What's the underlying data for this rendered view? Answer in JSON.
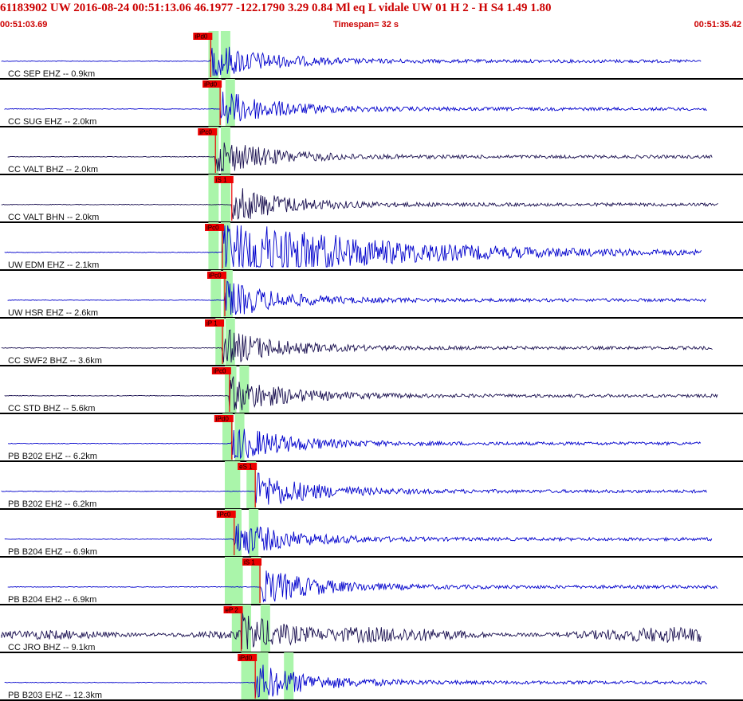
{
  "header": {
    "title": "61183902 UW 2016-08-24 00:51:13.06   46.1977 -122.1790   3.29  0.84 Ml  eq  L vidale   UW 01  H   2  -  H S4    1.49  1.80",
    "start_time": "00:51:03.69",
    "timespan": "Timespan=  32 s",
    "end_time": "00:51:35.42"
  },
  "colors": {
    "title": "#cc0000",
    "trace_blue": "#0000cc",
    "trace_dark": "#1a1050",
    "pick_red": "#ee0000",
    "window_green": "#aaf5aa",
    "separator": "#000000"
  },
  "channels": [
    {
      "label": "CC SEP EHZ -- 0.9km",
      "color": "blue",
      "picks": [
        {
          "text": "iPd0",
          "t": 9.0
        }
      ],
      "windows": [
        8.9,
        9.7
      ]
    },
    {
      "label": "CC SUG EHZ -- 2.0km",
      "color": "blue",
      "picks": [
        {
          "text": "iPd0",
          "t": 9.4
        }
      ],
      "windows": [
        8.9,
        9.9
      ]
    },
    {
      "label": "CC VALT BHZ -- 2.0km",
      "color": "dark",
      "picks": [
        {
          "text": "iPc0",
          "t": 9.2
        }
      ],
      "windows": [
        8.9,
        9.7
      ]
    },
    {
      "label": "CC VALT BHN -- 2.0km",
      "color": "dark",
      "picks": [
        {
          "text": "iS 1",
          "t": 9.9
        }
      ],
      "windows": [
        8.9,
        9.7
      ]
    },
    {
      "label": "UW EDM EHZ -- 2.1km",
      "color": "blue",
      "picks": [
        {
          "text": "iPc0",
          "t": 9.5
        }
      ],
      "windows": [
        8.9,
        9.7
      ]
    },
    {
      "label": "UW HSR EHZ -- 2.6km",
      "color": "blue",
      "picks": [
        {
          "text": "iPc0",
          "t": 9.6
        }
      ],
      "windows": [
        9.0,
        9.8
      ]
    },
    {
      "label": "CC SWF2 BHZ -- 3.6km",
      "color": "dark",
      "picks": [
        {
          "text": "iP 1",
          "t": 9.5
        }
      ],
      "windows": [
        9.2,
        9.9
      ]
    },
    {
      "label": "CC STD BHZ -- 5.6km",
      "color": "dark",
      "picks": [
        {
          "text": "iPc0",
          "t": 9.8
        }
      ],
      "windows": [
        9.6,
        10.5
      ]
    },
    {
      "label": "PB B202 EHZ -- 6.2km",
      "color": "blue",
      "picks": [
        {
          "text": "iPd0",
          "t": 9.9
        }
      ],
      "windows": [
        9.5,
        10.3
      ]
    },
    {
      "label": "PB B202 EH2 -- 6.2km",
      "color": "blue",
      "picks": [
        {
          "text": "eS 1",
          "t": 10.9
        }
      ],
      "windows": [
        9.6,
        10.8
      ]
    },
    {
      "label": "PB B204 EHZ -- 6.9km",
      "color": "blue",
      "picks": [
        {
          "text": "iPc0",
          "t": 10.0
        }
      ],
      "windows": [
        9.6,
        10.9
      ]
    },
    {
      "label": "PB B204 EH2 -- 6.9km",
      "color": "blue",
      "picks": [
        {
          "text": "iS 1",
          "t": 11.1
        }
      ],
      "windows": [
        9.6,
        11.0
      ]
    },
    {
      "label": "CC JRO BHZ -- 9.1km",
      "color": "dark",
      "picks": [
        {
          "text": "eP 2",
          "t": 10.3
        }
      ],
      "windows": [
        9.9,
        11.4
      ]
    },
    {
      "label": "PB B203 EHZ -- 12.3km",
      "color": "blue",
      "picks": [
        {
          "text": "iPd0",
          "t": 10.9
        }
      ],
      "windows": [
        10.3,
        12.4
      ]
    }
  ]
}
